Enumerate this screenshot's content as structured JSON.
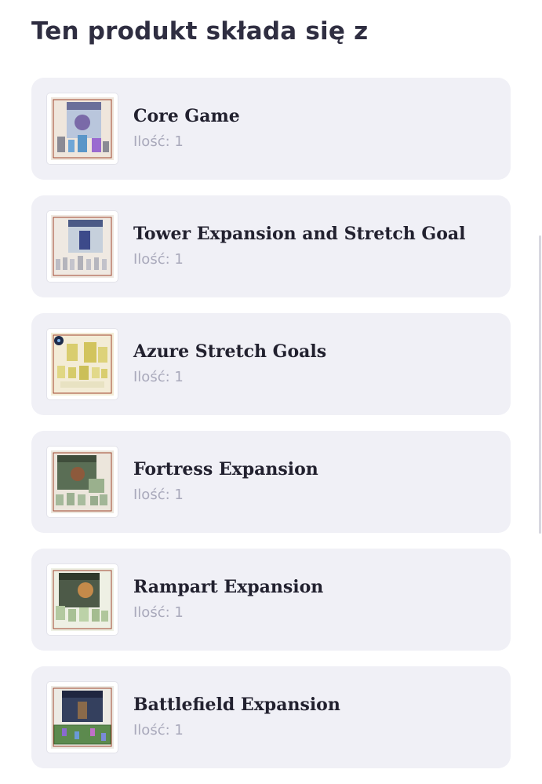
{
  "section": {
    "title": "Ten produkt składa się z"
  },
  "items": [
    {
      "name": "Core Game",
      "qty": "Ilość: 1",
      "icon": "board-game-box-image",
      "colors": [
        "#b9c6dc",
        "#6a6f9a"
      ]
    },
    {
      "name": "Tower Expansion and Stretch Goal",
      "qty": "Ilość: 1",
      "icon": "board-game-box-image",
      "colors": [
        "#c6d0dc",
        "#4b5a86"
      ]
    },
    {
      "name": "Azure Stretch Goals",
      "qty": "Ilość: 1",
      "icon": "miniatures-image",
      "colors": [
        "#e6dfa6",
        "#c9bf63"
      ]
    },
    {
      "name": "Fortress Expansion",
      "qty": "Ilość: 1",
      "icon": "board-game-box-image",
      "colors": [
        "#b8c8b0",
        "#5a6e55"
      ]
    },
    {
      "name": "Rampart Expansion",
      "qty": "Ilość: 1",
      "icon": "board-game-box-image",
      "colors": [
        "#c3d4b4",
        "#6b8457"
      ]
    },
    {
      "name": "Battlefield Expansion",
      "qty": "Ilość: 1",
      "icon": "board-game-box-image",
      "colors": [
        "#9fb3c9",
        "#3f6b4c"
      ]
    }
  ]
}
